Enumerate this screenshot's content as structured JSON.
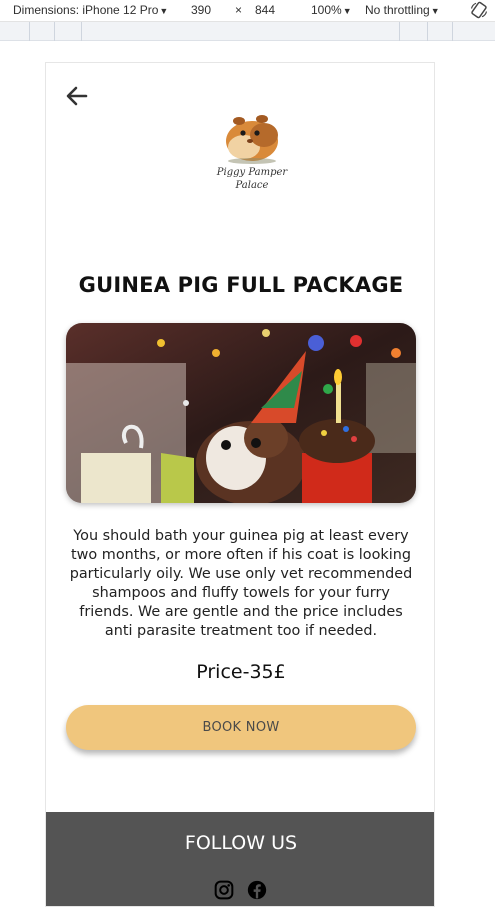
{
  "devtools": {
    "dimensions_label": "Dimensions: iPhone 12 Pro",
    "width": "390",
    "times": "×",
    "height": "844",
    "zoom": "100%",
    "throttling": "No throttling"
  },
  "logo": {
    "line1": "Piggy Pamper",
    "line2": "Palace"
  },
  "page": {
    "title": "GUINEA PIG FULL PACKAGE",
    "description": "You should bath your guinea pig at least every two months, or more often if his coat is looking particularly oily. We use only vet recommended shampoos and fluffy towels for your furry friends. We are gentle and the price includes anti parasite treatment too if needed.",
    "price": "Price-35£",
    "book_label": "BOOK NOW"
  },
  "footer": {
    "title": "FOLLOW US"
  },
  "colors": {
    "accent": "#f0c67d",
    "footer_bg": "#545454"
  },
  "icons": [
    "back-arrow-icon",
    "instagram-icon",
    "facebook-icon",
    "rotate-icon"
  ]
}
